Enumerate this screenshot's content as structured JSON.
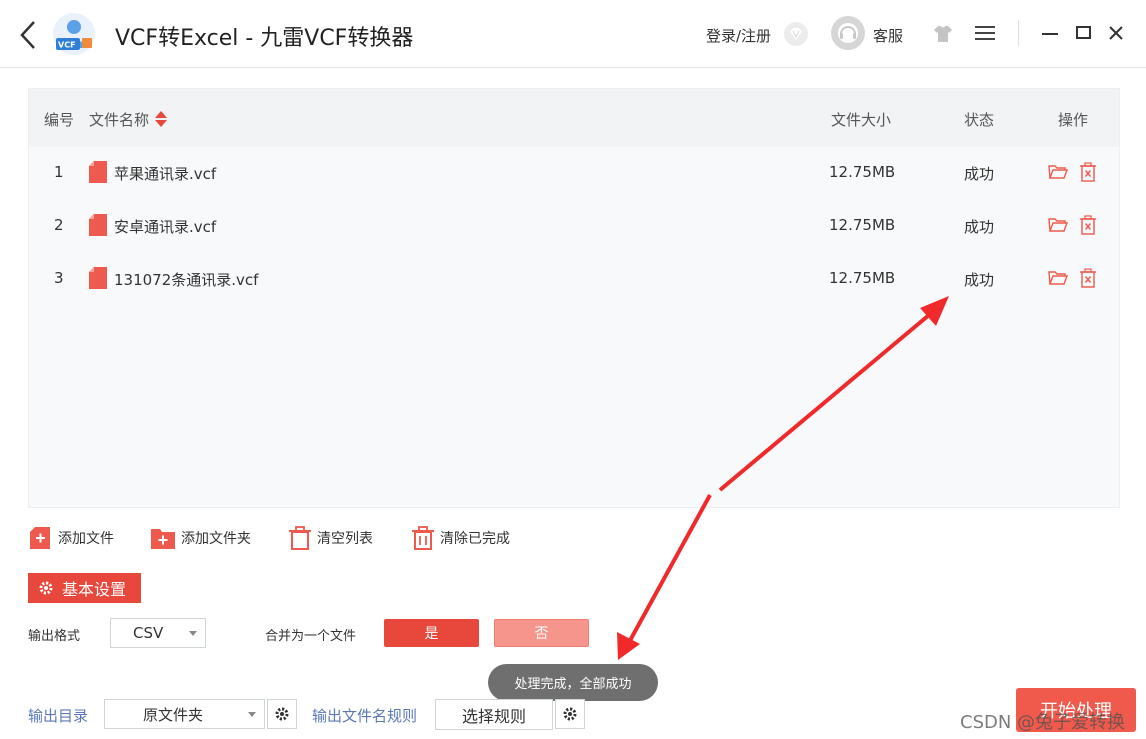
{
  "header": {
    "title": "VCF转Excel - 九雷VCF转换器",
    "logo_text": "VCF",
    "login_label": "登录/注册",
    "service_label": "客服",
    "icons": [
      "back-arrow-icon",
      "vip-diamond-icon",
      "headset-icon",
      "skin-shirt-icon",
      "menu-icon",
      "minimize-icon",
      "maximize-icon",
      "close-icon"
    ]
  },
  "table": {
    "columns": {
      "index": "编号",
      "name": "文件名称",
      "size": "文件大小",
      "status": "状态",
      "ops": "操作"
    },
    "rows": [
      {
        "index": "1",
        "name": "苹果通讯录.vcf",
        "size": "12.75MB",
        "status": "成功"
      },
      {
        "index": "2",
        "name": "安卓通讯录.vcf",
        "size": "12.75MB",
        "status": "成功"
      },
      {
        "index": "3",
        "name": "131072条通讯录.vcf",
        "size": "12.75MB",
        "status": "成功"
      }
    ]
  },
  "actions": {
    "add_file": "添加文件",
    "add_folder": "添加文件夹",
    "clear_list": "清空列表",
    "clear_done": "清除已完成"
  },
  "settings": {
    "tab_label": "基本设置",
    "output_format_label": "输出格式",
    "output_format_value": "CSV",
    "merge_label": "合并为一个文件",
    "merge_yes": "是",
    "merge_no": "否",
    "output_dir_label": "输出目录",
    "output_dir_value": "原文件夹",
    "name_rule_label": "输出文件名规则",
    "name_rule_button": "选择规则"
  },
  "toast": "处理完成，全部成功",
  "start_button": "开始处理",
  "watermark": "CSDN @兔子爱转换",
  "colors": {
    "accent": "#e8473b",
    "accent_light": "#f5958b",
    "link": "#5a78b8",
    "toast_bg": "#6f6f6f"
  }
}
